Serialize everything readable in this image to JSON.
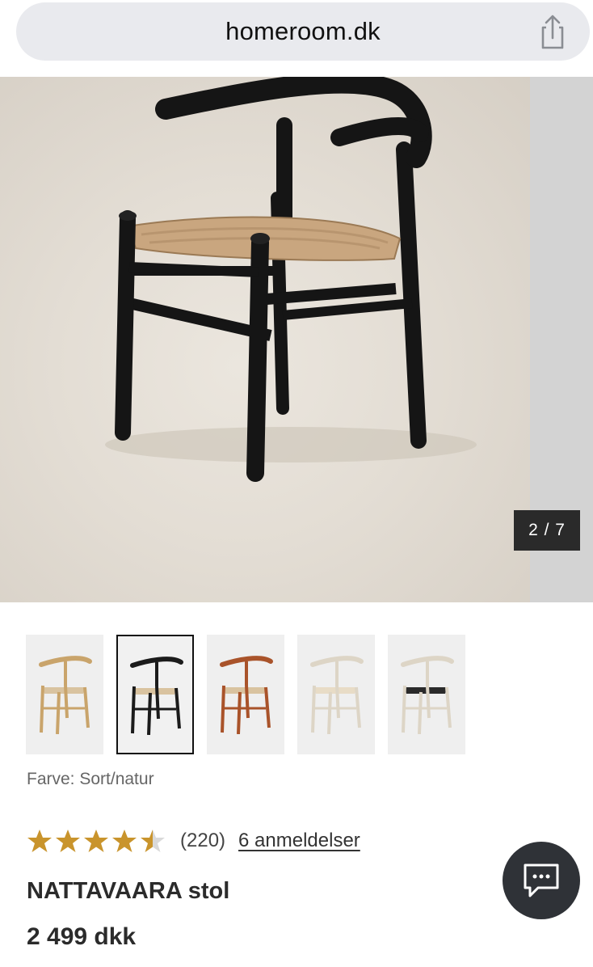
{
  "browser": {
    "url": "homeroom.dk"
  },
  "gallery": {
    "counter": "2 / 7"
  },
  "thumbnails": [
    {
      "color": "natur",
      "frame": "#c9a46b"
    },
    {
      "color": "sort/natur",
      "frame": "#1b1b1b"
    },
    {
      "color": "kirsebær",
      "frame": "#a9532a"
    },
    {
      "color": "hvid/natur",
      "frame": "#e4ddd0"
    },
    {
      "color": "hvid/sort",
      "frame": "#e4ddd0"
    }
  ],
  "colorInfo": {
    "label": "Farve: Sort/natur"
  },
  "rating": {
    "value": 4.5,
    "count": "(220)",
    "link": "6 anmeldelser"
  },
  "product": {
    "name": "NATTAVAARA stol",
    "price": "2 499 dkk"
  },
  "colors": {
    "star": "#c9942c",
    "starEmpty": "#d9d9d9"
  }
}
